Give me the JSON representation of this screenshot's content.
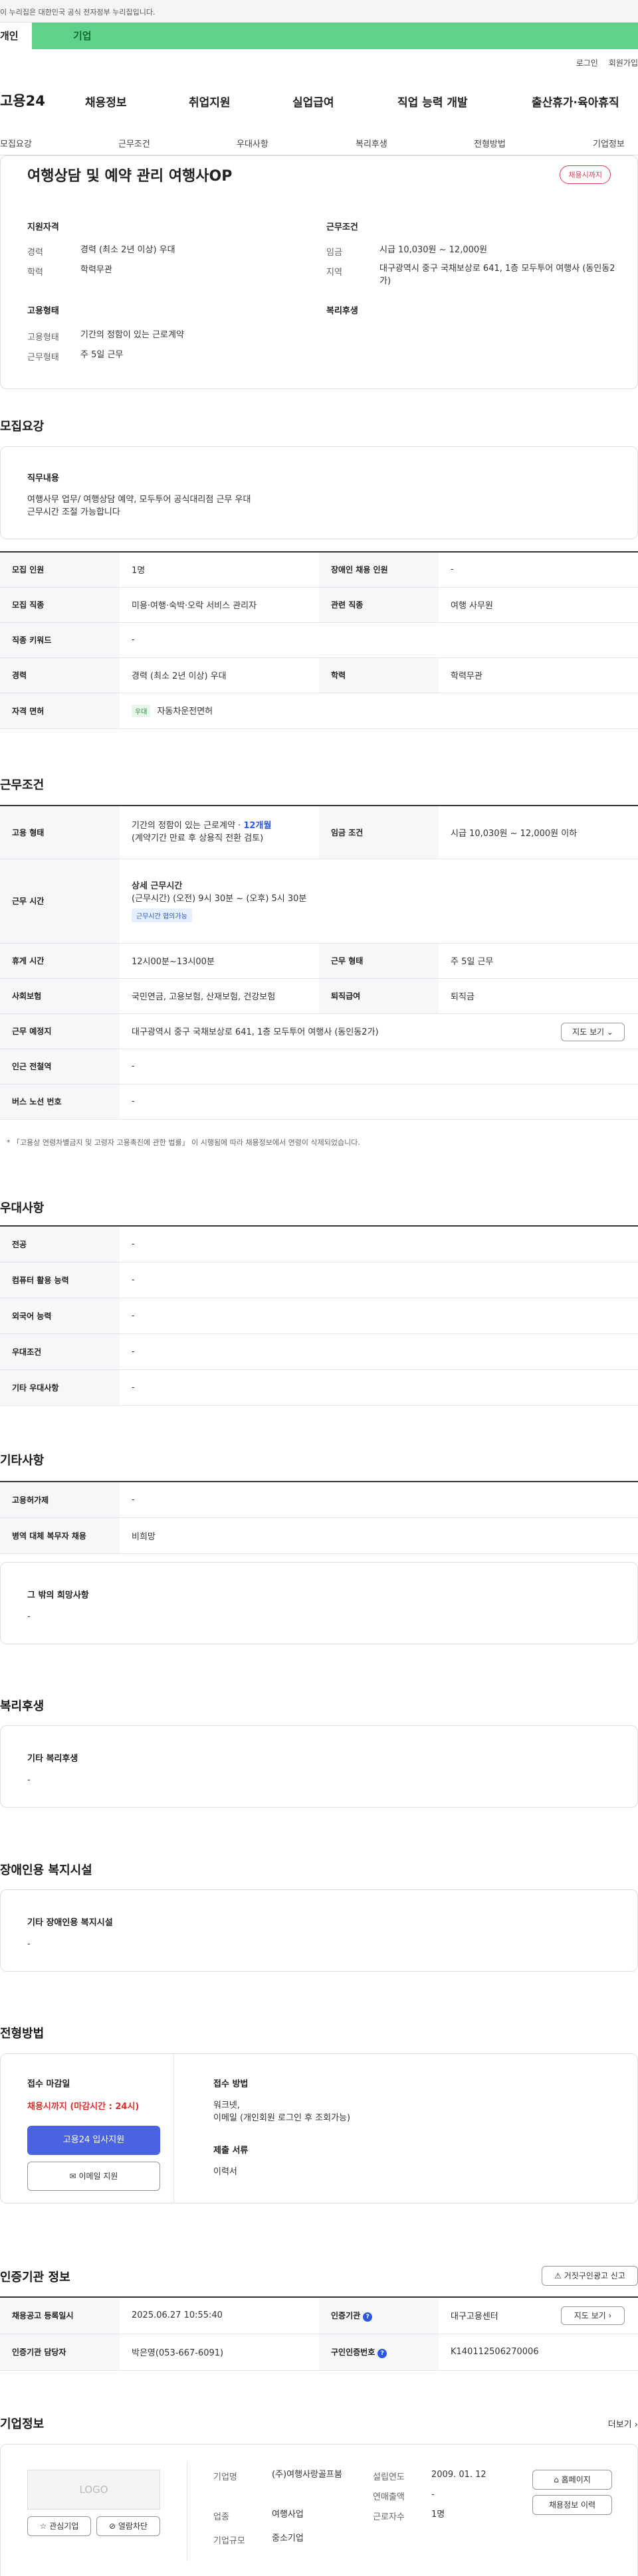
{
  "gov_banner": "이 누리집은 대한민국 공식 전자정부 누리집입니다.",
  "user_tabs": [
    "개인",
    "기업"
  ],
  "util_links": [
    "로그인",
    "회원가입"
  ],
  "logo": "고용24",
  "gnb": [
    "채용정보",
    "취업지원",
    "실업급여",
    "직업 능력 개발",
    "출산휴가·육아휴직"
  ],
  "subnav": [
    "모집요강",
    "근무조건",
    "우대사항",
    "복리후생",
    "전형방법",
    "기업정보"
  ],
  "job": {
    "title": "여행상담 및 예약 관리 여행사OP",
    "badge": "채용시까지",
    "qual_title": "지원자격",
    "career_label": "경력",
    "career": "경력 (최소 2년 이상) 우대",
    "edu_label": "학력",
    "edu": "학력무관",
    "cond_title": "근무조건",
    "wage_label": "임금",
    "wage": "시급 10,030원 ~ 12,000원",
    "loc_label": "지역",
    "loc": "대구광역시 중구 국채보상로 641, 1층 모두투어 여행사 (동인동2가)",
    "emp_title": "고용형태",
    "emptype_label": "고용형태",
    "emptype": "기간의 정함이 있는 근로계약",
    "worktype_label": "근무형태",
    "worktype": "주 5일 근무",
    "welfare_title": "복리후생"
  },
  "recruit": {
    "title": "모집요강",
    "duty_title": "직무내용",
    "duty_text": "여행사무 업무/ 여행상담 예약, 모두투어 공식대리점 근무 우대\n근무시간 조절 가능합니다",
    "rows": [
      [
        "모집 인원",
        "1명",
        "장애인 채용 인원",
        "-"
      ],
      [
        "모집 직종",
        "미용·여행·숙박·오락 서비스 관리자",
        "관련 직종",
        "여행 사무원"
      ],
      [
        "직종 키워드",
        "-"
      ],
      [
        "경력",
        "경력 (최소 2년 이상) 우대",
        "학력",
        "학력무관"
      ],
      [
        "자격 면허"
      ]
    ],
    "license_chip": "우대",
    "license": "자동차운전면허"
  },
  "conditions": {
    "title": "근무조건",
    "emp_k": "고용 형태",
    "emp_v1": "기간의 정함이 있는 근로계약 · ",
    "emp_v1b": "12개월",
    "emp_v2": "(계약기간 만료 후 상용직 전환 검토)",
    "wage_k": "임금 조건",
    "wage_v": "시급 10,030원 ~ 12,000원 이하",
    "time_k": "근무 시간",
    "time_h": "상세 근무시간",
    "time_v": "(근무시간) (오전) 9시 30분 ~ (오후) 5시 30분",
    "time_chip": "근무시간 협의가능",
    "rest_k": "휴게 시간",
    "rest_v": "12시00분~13시00분",
    "form_k": "근무 형태",
    "form_v": "주 5일 근무",
    "ins_k": "사회보험",
    "ins_v": "국민연금, 고용보험, 산재보험, 건강보험",
    "sev_k": "퇴직급여",
    "sev_v": "퇴직금",
    "place_k": "근무 예정지",
    "place_v": "대구광역시 중구 국채보상로 641, 1층 모두투어 여행사 (동인동2가)",
    "map_btn": "지도 보기",
    "subway_k": "인근 전철역",
    "subway_v": "-",
    "bus_k": "버스 노선 번호",
    "bus_v": "-",
    "note": "* 「고용상 연령차별금지 및 고령자 고용촉진에 관한 법률」 이 시행됨에 따라 채용정보에서 연령이 삭제되었습니다."
  },
  "prefer": {
    "title": "우대사항",
    "rows": [
      [
        "전공",
        "-"
      ],
      [
        "컴퓨터 활용 능력",
        "-"
      ],
      [
        "외국어 능력",
        "-"
      ],
      [
        "우대조건",
        "-"
      ],
      [
        "기타 우대사항",
        "-"
      ]
    ]
  },
  "etc": {
    "title": "기타사항",
    "rows": [
      [
        "고용허가제",
        "-"
      ],
      [
        "병역 대체 복무자 채용",
        "비희망"
      ]
    ],
    "other_title": "그 밖의 희망사항",
    "other_v": "-"
  },
  "welfare": {
    "title": "복리후생",
    "box_title": "기타 복리후생",
    "box_v": "-"
  },
  "disabled": {
    "title": "장애인용 복지시설",
    "box_title": "기타 장애인용 복지시설",
    "box_v": "-"
  },
  "process": {
    "title": "전형방법",
    "deadline_title": "접수 마감일",
    "deadline": "채용시까지 (마감시간 : 24시)",
    "apply_btn": "고용24 입사지원",
    "email_btn": "이메일 지원",
    "method_title": "접수 방법",
    "method_v": "워크넷,\n이메일 (개인회원 로그인 후 조회가능)",
    "docs_title": "제출 서류",
    "docs_v": "이력서"
  },
  "cert": {
    "title": "인증기관 정보",
    "report_btn": "거짓구인광고 신고",
    "reg_k": "채용공고 등록일시",
    "reg_v": "2025.06.27 10:55:40",
    "org_k": "인증기관",
    "org_v": "대구고용센터",
    "map_btn": "지도 보기",
    "mgr_k": "인증기관 담당자",
    "mgr_v": "박은영(053-667-6091)",
    "no_k": "구인인증번호",
    "no_v": "K140112506270006"
  },
  "company": {
    "title": "기업정보",
    "more": "더보기",
    "logo_text": "LOGO",
    "fav_btn": "관심기업",
    "block_btn": "열람차단",
    "name_k": "기업명",
    "name_v": "(주)여행사랑골프붐",
    "ind_k": "업종",
    "ind_v": "여행사업",
    "size_k": "기업규모",
    "size_v": "중소기업",
    "est_k": "설립연도",
    "est_v": "2009. 01. 12",
    "sales_k": "연매출액",
    "sales_v": "-",
    "emp_k": "근로자수",
    "emp_v": "1명",
    "home_btn": "홈페이지",
    "hist_btn": "채용정보 이력"
  }
}
